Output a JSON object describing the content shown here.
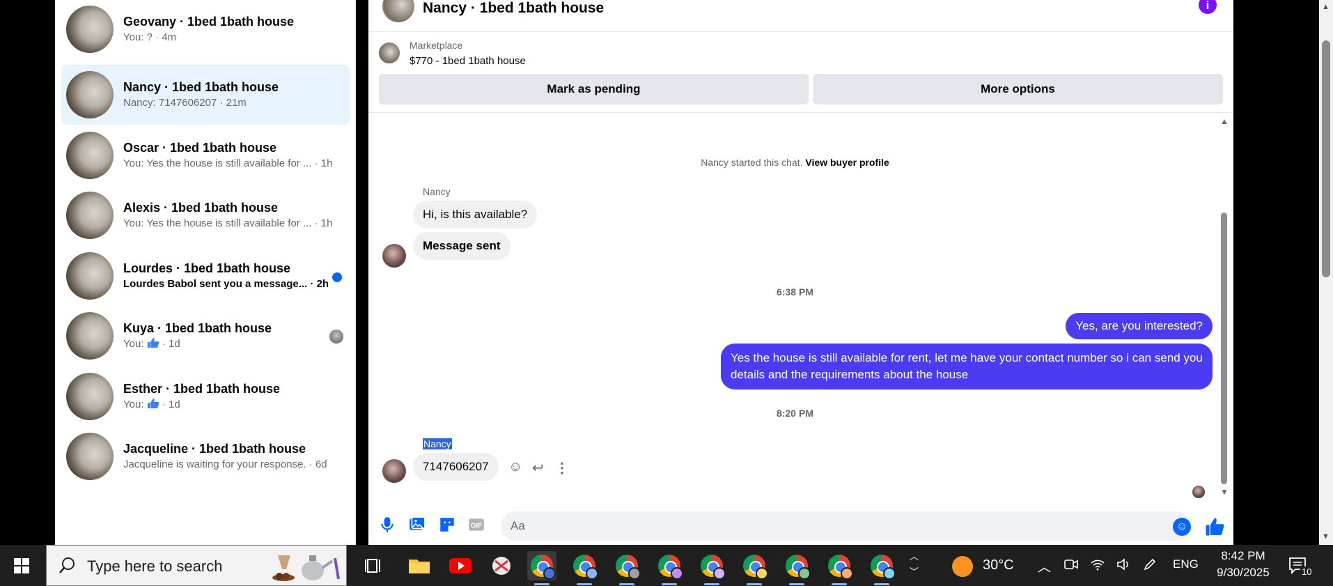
{
  "conversations": [
    {
      "name": "Geovany · 1bed 1bath house",
      "preview": "You: ? · 4m",
      "active": false,
      "unread": false
    },
    {
      "name": "Nancy · 1bed 1bath house",
      "preview": "Nancy: 7147606207 · 21m",
      "active": true,
      "unread": false
    },
    {
      "name": "Oscar · 1bed 1bath house",
      "preview": "You: Yes the house is still available for ... · 1h",
      "active": false,
      "unread": false
    },
    {
      "name": "Alexis · 1bed 1bath house",
      "preview": "You: Yes the house is still available for ... · 1h",
      "active": false,
      "unread": false
    },
    {
      "name": "Lourdes · 1bed 1bath house",
      "preview": "Lourdes Babol sent you a message... · 2h",
      "active": false,
      "unread": true
    },
    {
      "name": "Kuya · 1bed 1bath house",
      "preview_prefix": "You:",
      "preview_suffix": "· 1d",
      "active": false,
      "unread": false
    },
    {
      "name": "Esther · 1bed 1bath house",
      "preview_prefix": "You:",
      "preview_suffix": "· 1d",
      "active": false,
      "unread": false
    },
    {
      "name": "Jacqueline · 1bed 1bath house",
      "preview": "Jacqueline is waiting for your response. · 6d",
      "active": false,
      "unread": false
    }
  ],
  "chat": {
    "title": "Nancy · 1bed 1bath house",
    "info_icon": "i",
    "listing_source": "Marketplace",
    "listing_title": "$770 - 1bed 1bath house",
    "mark_pending": "Mark as pending",
    "more_options": "More options",
    "started_note": "Nancy started this chat.",
    "view_profile": "View buyer profile",
    "sender1": "Nancy",
    "msg1": "Hi, is this available?",
    "msg2": "Message sent",
    "time1": "6:38 PM",
    "out1": "Yes, are you interested?",
    "out2": "Yes the house is still available for rent, let me have your contact number so i can send you details and the requirements about the house",
    "time2": "8:20 PM",
    "sender2": "Nancy",
    "msg3": "7147606207",
    "input_placeholder": "Aa"
  },
  "taskbar": {
    "search_placeholder": "Type here to search",
    "temperature": "30°C",
    "language": "ENG",
    "time": "8:42 PM",
    "date": "9/30/2025",
    "notification_count": "10"
  },
  "colors": {
    "outgoing_bubble": "#4b3bf3",
    "accent": "#0866ff",
    "active_conversation": "#e7f3ff"
  }
}
